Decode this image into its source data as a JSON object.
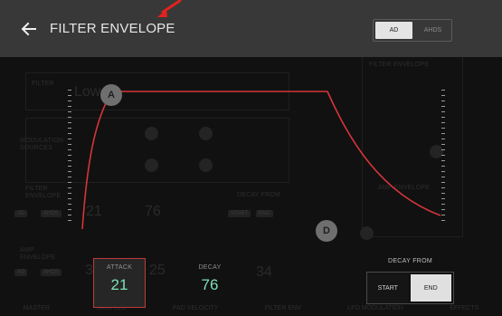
{
  "header": {
    "title": "FILTER ENVELOPE",
    "mode_options": [
      "AD",
      "AHDS"
    ],
    "selected_mode": "AD"
  },
  "graph": {
    "attack_handle_label": "A",
    "decay_handle_label": "D"
  },
  "params": {
    "attack": {
      "label": "ATTACK",
      "value": "21"
    },
    "decay": {
      "label": "DECAY",
      "value": "76"
    }
  },
  "decay_from": {
    "label": "DECAY FROM",
    "options": [
      "START",
      "END"
    ],
    "selected": "END"
  },
  "colors": {
    "header_bg": "#383838",
    "envelope_line": "#d6353a",
    "value_text": "#7fe0b7",
    "attack_border": "#c0393b"
  },
  "background_screen": {
    "left_labels": [
      "FILTER",
      "MODULATION SOURCES",
      "FILTER ENVELOPE",
      "AMP ENVELOPE"
    ],
    "right_labels": [
      "FILTER ENVELOPE",
      "AMP ENVELOPE"
    ],
    "decay_from_label": "DECAY FROM",
    "decay_from_options": [
      "START",
      "END"
    ],
    "filter_env_modes": [
      "AD",
      "AHDS"
    ],
    "amp_env_modes": [
      "AD",
      "AHDS"
    ],
    "filter_type_text": "Low",
    "values": [
      "21",
      "76",
      "37",
      "25",
      "34"
    ],
    "bottom_tabs": [
      "MASTER",
      "SAMPLES",
      "PAD VELOCITY",
      "FILTER ENV",
      "LFO MODULATION",
      "EFFECTS"
    ]
  }
}
